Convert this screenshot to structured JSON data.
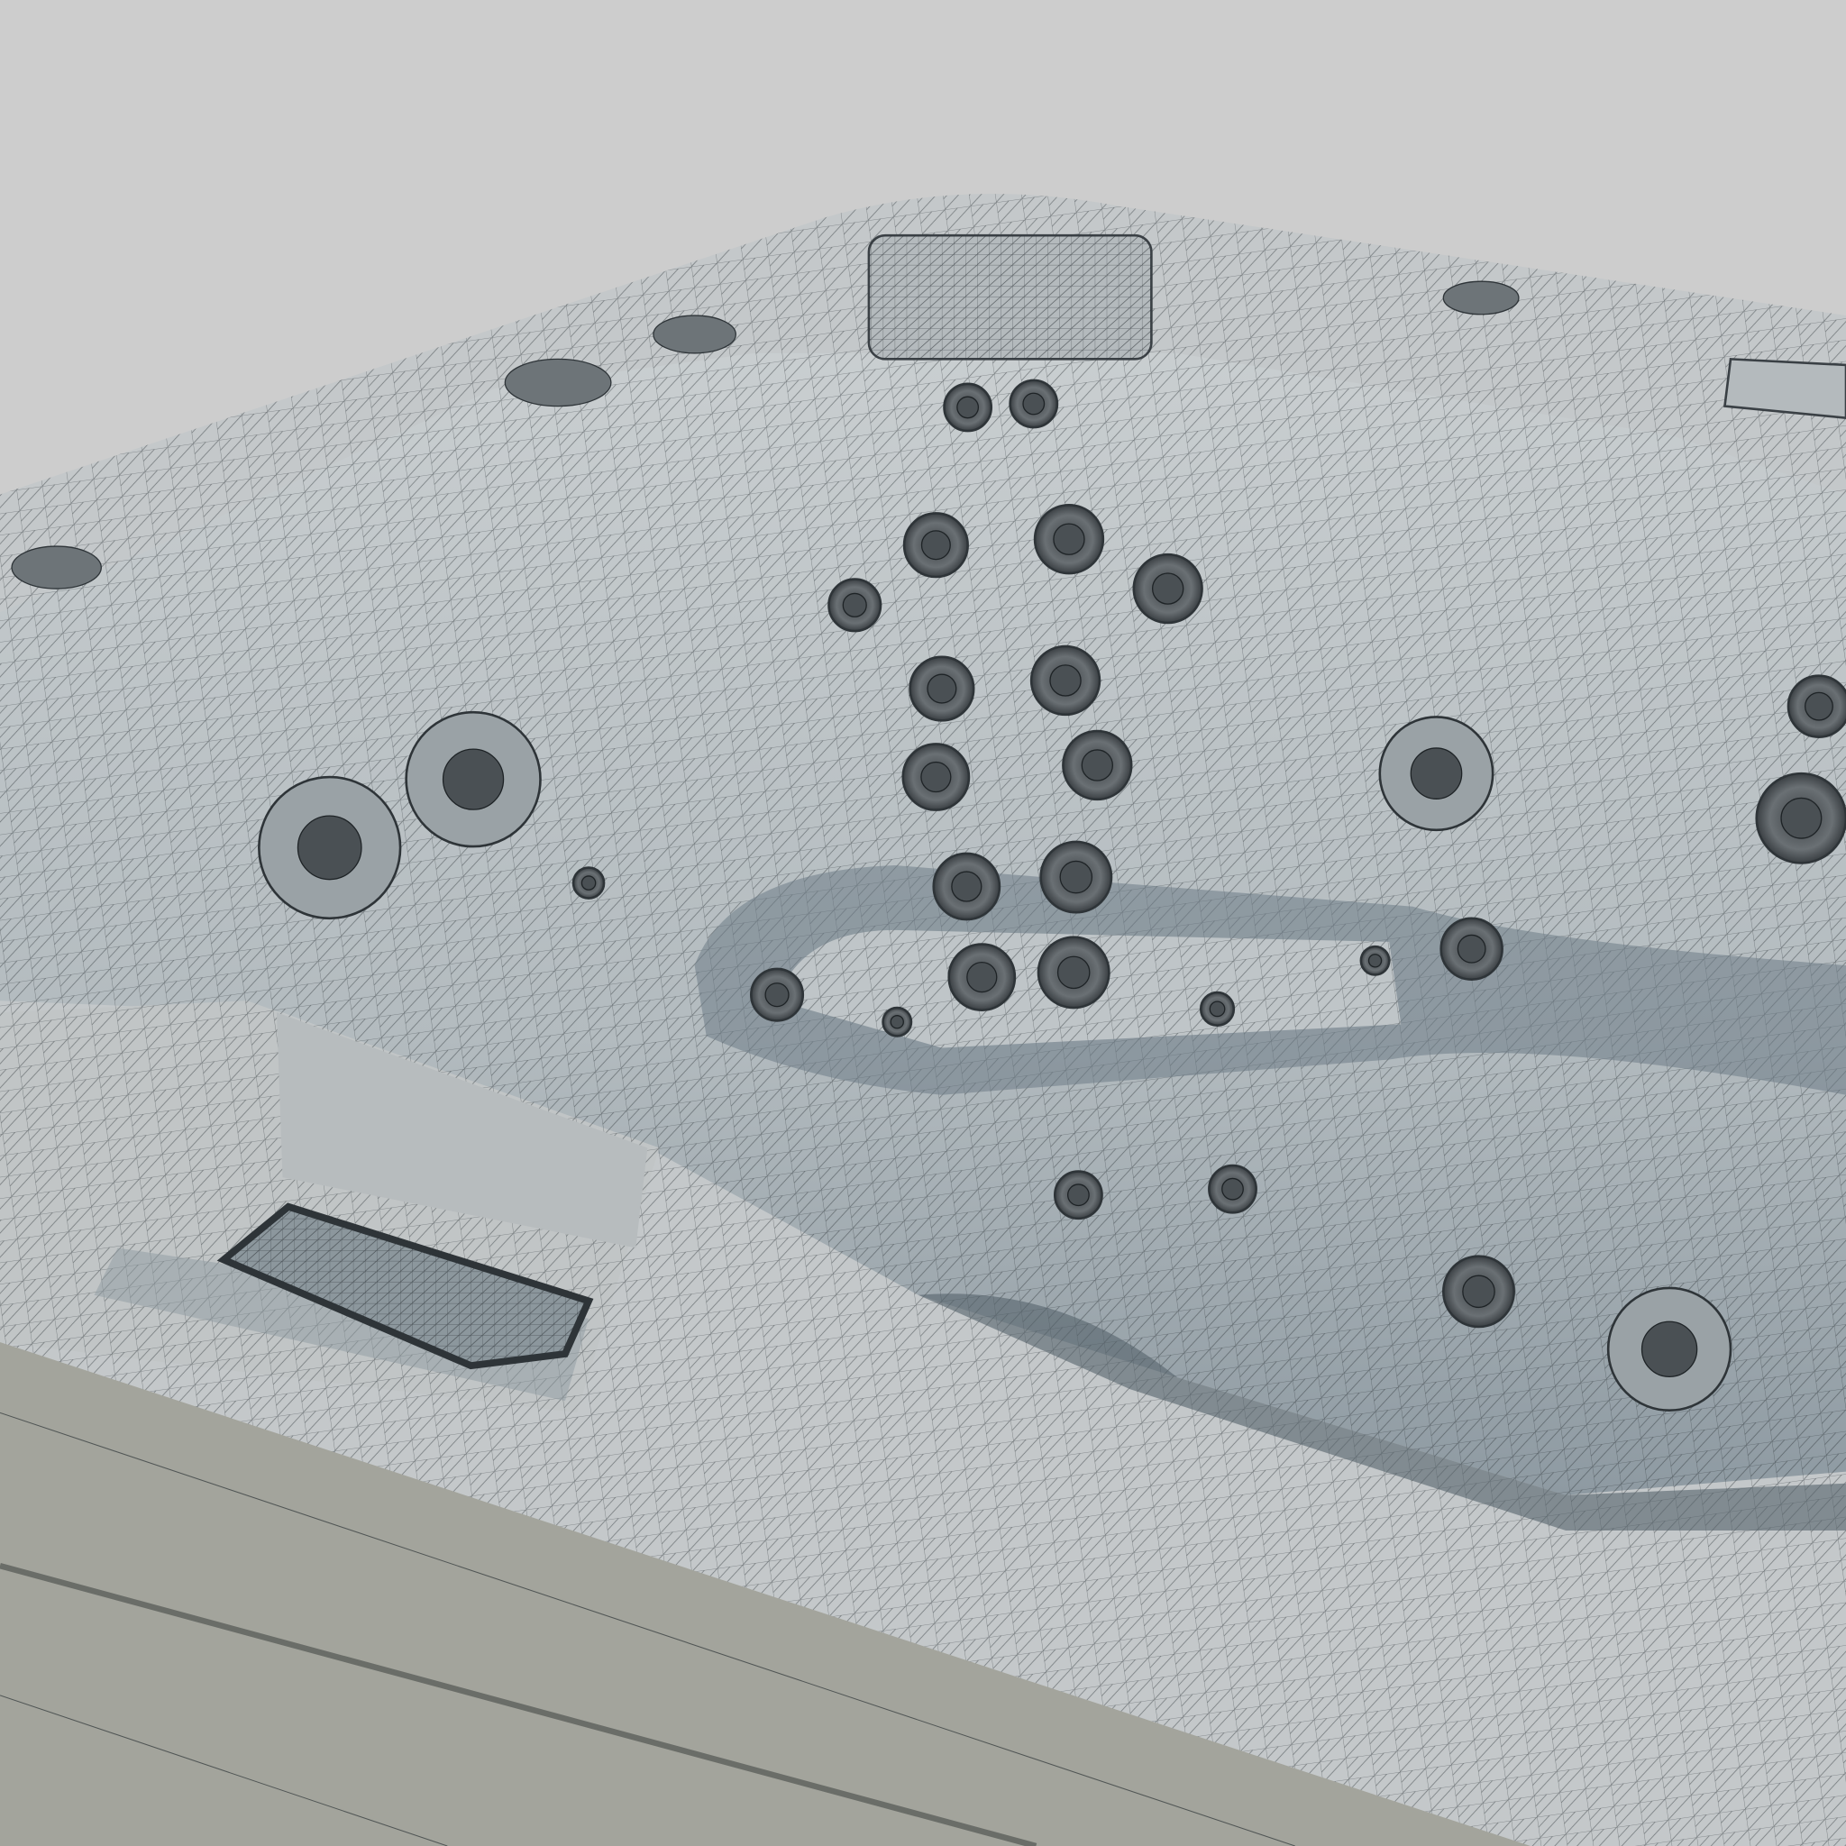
{
  "colors": {
    "background": "#cdcdcd",
    "shell": "#bfc4c6",
    "shell_shadow": "#5f6e78",
    "cabinet": "#a3a49c",
    "wire": "#2e3438",
    "jet": "#555b5f"
  }
}
